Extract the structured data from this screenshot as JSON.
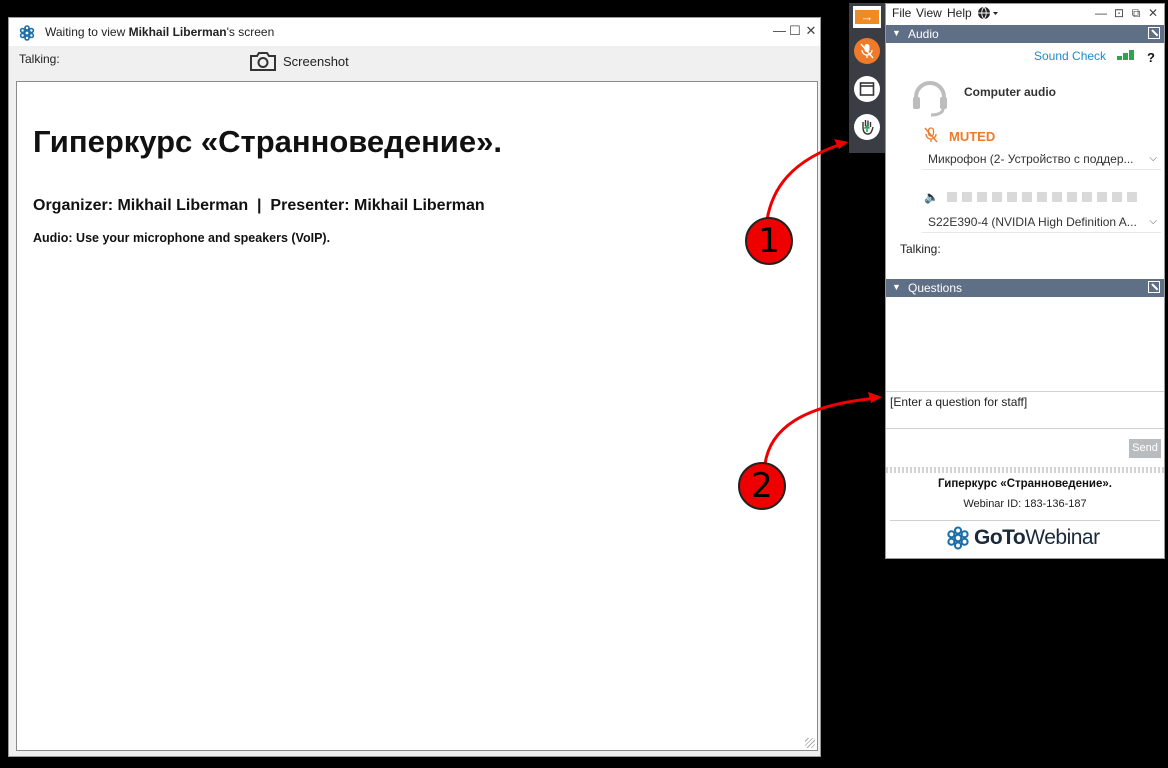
{
  "viewer": {
    "title_prefix": "Waiting to view ",
    "title_name": "Mikhail Liberman",
    "title_suffix": "'s screen",
    "talking_label": "Talking:",
    "screenshot_label": "Screenshot",
    "slide": {
      "heading": "Гиперкурс «Странноведение».",
      "organizer_line": "Organizer: Mikhail Liberman  |  Presenter: Mikhail Liberman",
      "audio_line": "Audio: Use your microphone and speakers (VoIP)."
    }
  },
  "panel": {
    "menu": [
      "File",
      "View",
      "Help"
    ],
    "audio_section": {
      "title": "Audio",
      "sound_check": "Sound Check",
      "help": "?",
      "mode": "Computer audio",
      "status": "MUTED",
      "microphone": "Микрофон (2- Устройство с поддер...",
      "speaker": "S22E390-4 (NVIDIA High Definition A...",
      "talking_label": "Talking:",
      "level_segments": 13
    },
    "questions_section": {
      "title": "Questions",
      "input_placeholder": "[Enter a question for staff]",
      "send_label": "Send"
    },
    "footer": {
      "webinar_title": "Гиперкурс «Странноведение».",
      "webinar_id": "Webinar ID: 183-136-187",
      "brand_goto": "GoTo",
      "brand_webinar": "Webinar"
    }
  },
  "annotations": {
    "badge1": "1",
    "badge2": "2"
  },
  "colors": {
    "accent_orange": "#ef7b2a",
    "section_bar": "#5f6f86",
    "link_blue": "#1b8cd0",
    "signal_green": "#2ea44f",
    "annotation_red": "#e00000"
  }
}
